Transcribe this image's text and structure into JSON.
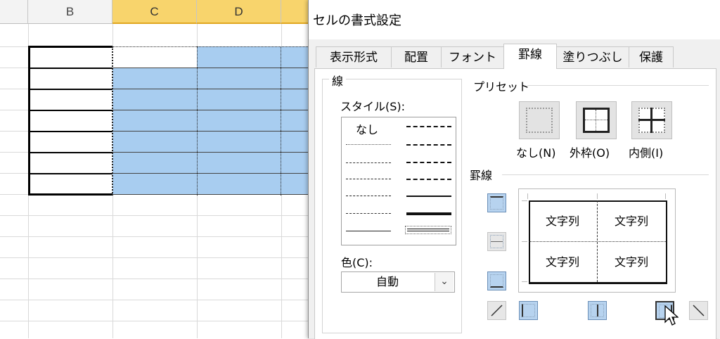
{
  "sheet": {
    "columns": [
      "B",
      "C",
      "D"
    ]
  },
  "dialog": {
    "title": "セルの書式設定",
    "tabs": [
      "表示形式",
      "配置",
      "フォント",
      "罫線",
      "塗りつぶし",
      "保護"
    ],
    "active_tab": "罫線",
    "line_group": {
      "title": "線",
      "style_label": "スタイル(S):",
      "none_label": "なし",
      "color_label": "色(C):",
      "color_value": "自動"
    },
    "presets": {
      "title": "プリセット",
      "items": [
        "なし(N)",
        "外枠(O)",
        "内側(I)"
      ]
    },
    "border": {
      "title": "罫線",
      "preview_texts": [
        "文字列",
        "文字列",
        "文字列",
        "文字列"
      ]
    }
  },
  "colors": {
    "selection": "#a8cdf0",
    "header_selected": "#f8d46c",
    "button_active": "#b7d3ef"
  }
}
